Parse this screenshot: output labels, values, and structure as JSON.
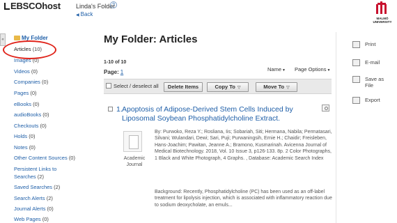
{
  "header": {
    "logo_text": "EBSCOhost",
    "folder_title": "Linda's Folder",
    "help_icon": "?",
    "back_label": "Back",
    "university_name": "MALMÖ UNIVERSITY"
  },
  "sidebar": {
    "collapse_glyph": "«",
    "my_folder_label": "My Folder",
    "items": [
      {
        "label": "Articles",
        "count": "(10)",
        "active": true
      },
      {
        "label": "Images",
        "count": "(0)"
      },
      {
        "label": "Videos",
        "count": "(0)"
      },
      {
        "label": "Companies",
        "count": "(0)"
      },
      {
        "label": "Pages",
        "count": "(0)"
      },
      {
        "label": "eBooks",
        "count": "(0)"
      },
      {
        "label": "audioBooks",
        "count": "(0)"
      },
      {
        "label": "Checkouts",
        "count": "(0)"
      },
      {
        "label": "Holds",
        "count": "(0)"
      },
      {
        "label": "Notes",
        "count": "(0)"
      },
      {
        "label": "Other Content Sources",
        "count": "(0)"
      },
      {
        "label": "Persistent Links to",
        "label2": "Searches",
        "count": "(2)"
      },
      {
        "label": "Saved Searches",
        "count": "(2)"
      },
      {
        "label": "Search Alerts",
        "count": "(2)"
      },
      {
        "label": "Journal Alerts",
        "count": "(0)"
      },
      {
        "label": "Web Pages",
        "count": "(0)"
      }
    ]
  },
  "main": {
    "title": "My Folder: Articles",
    "result_count": "1-10 of 10",
    "page_label": "Page:",
    "page_number": "1",
    "sort_label": "Name",
    "page_options_label": "Page Options",
    "select_all_label": "Select / deselect all",
    "delete_button": "Delete Items",
    "copy_button": "Copy To",
    "move_button": "Move To"
  },
  "results": [
    {
      "number": "1.",
      "title": "Apoptosis of Adipose-Derived Stem Cells Induced by Liposomal Soybean Phosphatidylcholine Extract.",
      "type": "Academic Journal",
      "meta": "By: Purwoko, Reza Y.; Rosliana, Iis; Sobariah, Siti; Hermana, Nabila; Permatasari, Silvani; Wulandari, Dewi; Sari, Puji; Purwaningsih, Ernie H.; Chaidir; Freisleben, Hans-Joachim; Pawitan, Jeanne A.; Bramono, Kusmarinah. Avicenna Journal of Medical Biotechnology. 2018, Vol. 10 Issue 3, p126-133. 8p. 2 Color Photographs, 1 Black and White Photograph, 4 Graphs. , Database: Academic Search Index",
      "abstract": "Background: Recently, Phosphatidylcholine (PC) has been used as an off-label treatment for lipolysis injection, which is associated with inflammatory reaction due to sodium deoxycholate, an emuls..."
    }
  ],
  "tools": [
    {
      "label": "Print",
      "icon": "printer-icon"
    },
    {
      "label": "E-mail",
      "icon": "email-icon"
    },
    {
      "label": "Save as",
      "label2": "File",
      "icon": "save-icon"
    },
    {
      "label": "Export",
      "icon": "export-icon"
    }
  ],
  "colors": {
    "link": "#1f5fa8",
    "annotation_circle": "#e0241b",
    "brand_red": "#c8102e"
  }
}
